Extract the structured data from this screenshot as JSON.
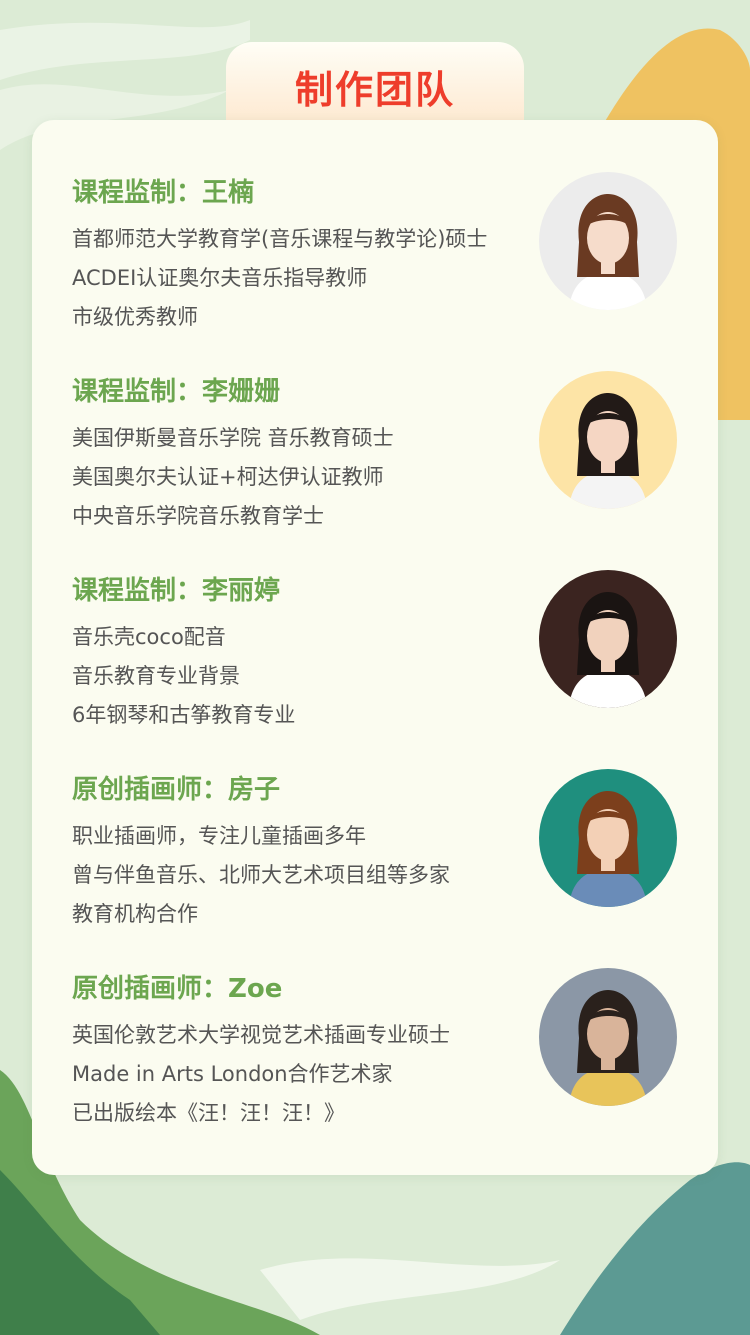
{
  "header": {
    "title": "制作团队"
  },
  "members": [
    {
      "title": "课程监制：王楠",
      "lines": [
        "首都师范大学教育学(音乐课程与教学论)硕士",
        "ACDEI认证奥尔夫音乐指导教师",
        "市级优秀教师"
      ],
      "photo": {
        "bg": "#ececec",
        "hair": "#6a3a22",
        "skin": "#f6dccb",
        "shirt": "#ffffff"
      }
    },
    {
      "title": "课程监制：李姗姗",
      "lines": [
        "美国伊斯曼音乐学院 音乐教育硕士",
        "美国奥尔夫认证+柯达伊认证教师",
        "中央音乐学院音乐教育学士"
      ],
      "photo": {
        "bg": "#fde4a6",
        "hair": "#221a17",
        "skin": "#f5d6c3",
        "shirt": "#f4f4f4"
      }
    },
    {
      "title": "课程监制：李丽婷",
      "lines": [
        "音乐壳coco配音",
        "音乐教育专业背景",
        "6年钢琴和古筝教育专业"
      ],
      "photo": {
        "bg": "#3b2420",
        "hair": "#1a1412",
        "skin": "#f1d2bd",
        "shirt": "#ffffff"
      }
    },
    {
      "title": "原创插画师：房子",
      "lines": [
        "职业插画师，专注儿童插画多年",
        "曾与伴鱼音乐、北师大艺术项目组等多家",
        "教育机构合作"
      ],
      "photo": {
        "bg": "#1f8f7e",
        "hair": "#7c3f1c",
        "skin": "#f3d0b6",
        "shirt": "#6a8cb8"
      }
    },
    {
      "title": "原创插画师：Zoe",
      "lines": [
        "英国伦敦艺术大学视觉艺术插画专业硕士",
        "Made in Arts London合作艺术家",
        "已出版绘本《汪！汪！汪！》"
      ],
      "photo": {
        "bg": "#8b97a6",
        "hair": "#2a211c",
        "skin": "#d9b49a",
        "shirt": "#e8c45a"
      }
    }
  ]
}
